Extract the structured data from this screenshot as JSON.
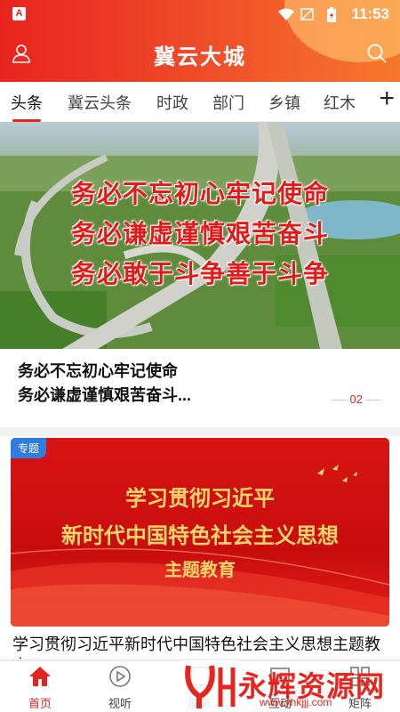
{
  "status": {
    "time": "11:53"
  },
  "header": {
    "title": "冀云大城",
    "icons": [
      "user-icon",
      "search-icon"
    ]
  },
  "tabs": [
    {
      "label": "头条",
      "active": true
    },
    {
      "label": "冀云头条"
    },
    {
      "label": "时政"
    },
    {
      "label": "部门"
    },
    {
      "label": "乡镇"
    },
    {
      "label": "红木"
    }
  ],
  "tabs_more": "+",
  "hero": {
    "slogans": [
      "务必不忘初心牢记使命",
      "务必谦虚谨慎艰苦奋斗",
      "务必敢于斗争善于斗争"
    ],
    "caption_lines": [
      "务必不忘初心牢记使命",
      "务必谦虚谨慎艰苦奋斗..."
    ],
    "page": "02"
  },
  "card": {
    "badge": "专题",
    "banner_lines": [
      "学习贯彻习近平",
      "新时代中国特色社会主义思想",
      "主题教育"
    ],
    "text": "学习贯彻习近平新时代中国特色社会主义思想主题教育"
  },
  "nav": [
    {
      "label": "首页",
      "icon": "home-icon",
      "active": true
    },
    {
      "label": "视听",
      "icon": "play-icon"
    },
    {
      "label": "服务",
      "icon": "service-icon"
    },
    {
      "label": "互动",
      "icon": "chat-icon"
    },
    {
      "label": "矩阵",
      "icon": "grid-icon"
    }
  ],
  "watermark": {
    "text": "永辉资源网",
    "url": "www.yhkjjj.com"
  },
  "colors": {
    "brand": "#e8241f",
    "badge": "#2f7de1",
    "gold": "#f6d56a"
  }
}
